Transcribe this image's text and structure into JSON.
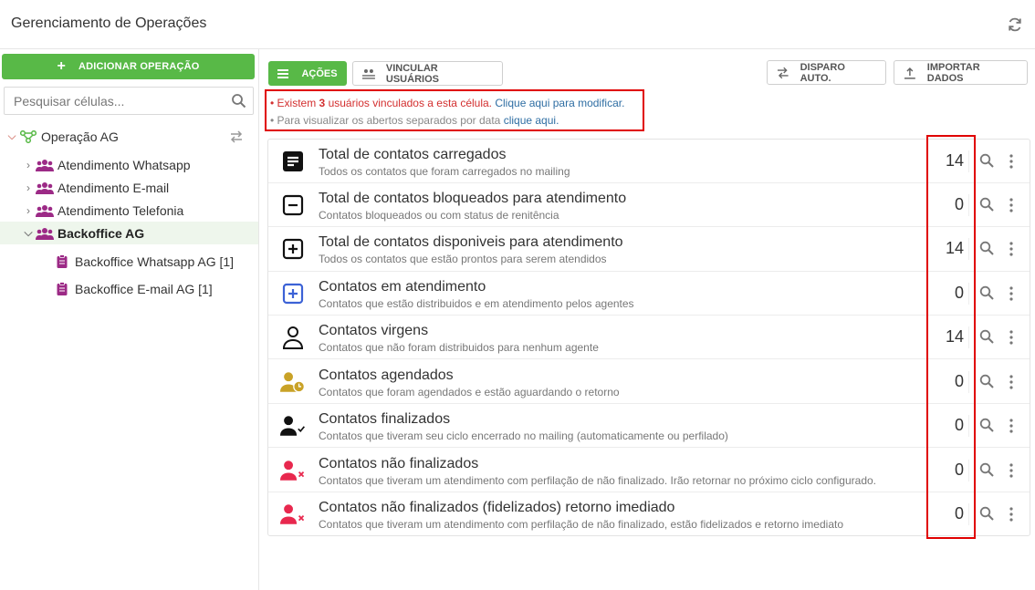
{
  "header": {
    "title": "Gerenciamento de Operações",
    "refresh_icon": "refresh-icon"
  },
  "sidebar": {
    "add_button": "ADICIONAR OPERAÇÃO",
    "search_placeholder": "Pesquisar células...",
    "tree": [
      {
        "label": "Operação AG",
        "icon": "operation-network-icon",
        "expanded": true
      },
      {
        "label": "Atendimento Whatsapp",
        "icon": "group-icon"
      },
      {
        "label": "Atendimento E-mail",
        "icon": "group-icon"
      },
      {
        "label": "Atendimento Telefonia",
        "icon": "group-icon"
      },
      {
        "label": "Backoffice AG",
        "icon": "group-icon",
        "selected": true
      },
      {
        "label": "Backoffice Whatsapp AG [1]",
        "icon": "clipboard-icon"
      },
      {
        "label": "Backoffice E-mail AG [1]",
        "icon": "clipboard-icon"
      }
    ]
  },
  "toolbar": {
    "acoes": "AÇÕES",
    "vincular": "VINCULAR USUÁRIOS",
    "disparo": "DISPARO AUTO.",
    "importar": "IMPORTAR DADOS"
  },
  "notice": {
    "line1_prefix": "• Existem ",
    "line1_count": "3",
    "line1_text": " usuários vinculados a esta célula. ",
    "line1_link": "Clique aqui para modificar.",
    "line2_text": "• Para visualizar os abertos separados por data ",
    "line2_link": "clique aqui."
  },
  "items": [
    {
      "title": "Total de contatos carregados",
      "desc": "Todos os contatos que foram carregados no mailing",
      "value": "14",
      "icon": "list-box-icon"
    },
    {
      "title": "Total de contatos bloqueados para atendimento",
      "desc": "Contatos bloqueados ou com status de renitência",
      "value": "0",
      "icon": "minus-box-icon"
    },
    {
      "title": "Total de contatos disponiveis para atendimento",
      "desc": "Todos os contatos que estão prontos para serem atendidos",
      "value": "14",
      "icon": "plus-box-icon"
    },
    {
      "title": "Contatos em atendimento",
      "desc": "Contatos que estão distribuidos e em atendimento pelos agentes",
      "value": "0",
      "icon": "plus-box-blue-icon"
    },
    {
      "title": "Contatos virgens",
      "desc": "Contatos que não foram distribuidos para nenhum agente",
      "value": "14",
      "icon": "user-outline-icon"
    },
    {
      "title": "Contatos agendados",
      "desc": "Contatos que foram agendados e estão aguardando o retorno",
      "value": "0",
      "icon": "user-clock-icon"
    },
    {
      "title": "Contatos finalizados",
      "desc": "Contatos que tiveram seu ciclo encerrado no mailing (automaticamente ou perfilado)",
      "value": "0",
      "icon": "user-check-icon"
    },
    {
      "title": "Contatos não finalizados",
      "desc": "Contatos que tiveram um atendimento com perfilação de não finalizado. Irão retornar no próximo ciclo configurado.",
      "value": "0",
      "icon": "user-x-icon"
    },
    {
      "title": "Contatos não finalizados (fidelizados) retorno imediado",
      "desc": "Contatos que tiveram um atendimento com perfilação de não finalizado, estão fidelizados e retorno imediato",
      "value": "0",
      "icon": "user-x-icon"
    }
  ],
  "colors": {
    "accent_green": "#58b947",
    "highlight_red": "#e00000",
    "link_blue": "#2f6ea3",
    "tree_purple": "#9c2a86",
    "gold": "#c9a227",
    "red_user": "#e8284e"
  }
}
